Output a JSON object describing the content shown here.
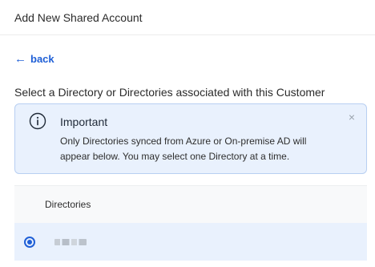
{
  "header": {
    "title": "Add New Shared Account"
  },
  "back": {
    "label": "back"
  },
  "prompt": {
    "text": "Select a Directory or Directories associated with this Customer"
  },
  "alert": {
    "title": "Important",
    "body": "Only Directories synced from Azure or On-premise AD will appear below. You may select one Directory at a time.",
    "close": "×"
  },
  "table": {
    "column": "Directories",
    "rows": [
      {
        "selected": true,
        "name_redacted": true
      }
    ]
  },
  "colors": {
    "accent": "#1f5fd6",
    "alert_bg": "#e9f1fd",
    "alert_border": "#b8cff2"
  }
}
